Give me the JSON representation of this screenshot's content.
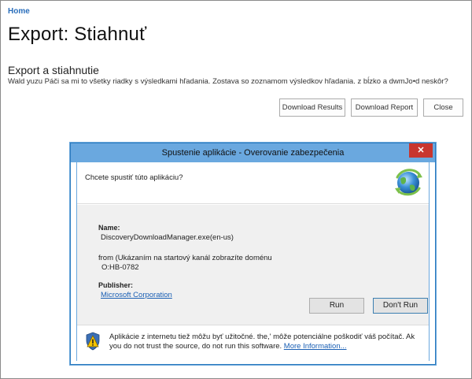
{
  "page": {
    "home_link": "Home",
    "title": "Export: Stiahnuť",
    "section_title": "Export a stiahnutie",
    "section_description": "Wald yuzu Páči sa mi to všetky riadky s výsledkami hľadania. Zostava so zoznamom výsledkov hľadania. z bĺzko a dwmJo•d neskôr?"
  },
  "toolbar": {
    "download_results": "Download Results",
    "download_report": "Download Report",
    "close": "Close"
  },
  "dialog": {
    "title": "Spustenie aplikácie - Overovanie zabezpečenia",
    "close_glyph": "✕",
    "question": "Chcete spustiť túto aplikáciu?",
    "name_label": "Name:",
    "name_value": "DiscoveryDownloadManager.exe(en-us)",
    "from_line_1": "from (Ukázaním na startový kanál zobrazíte doménu",
    "from_line_2": "O:HB-0782",
    "publisher_label": "Publisher:",
    "publisher_value": "Microsoft Corporation",
    "run_button": "Run",
    "dont_run_button": "Don't Run",
    "warning_line_1": "Aplikácie z internetu tiež môžu byť užitočné. the,' môže potenciálne poškodiť váš počítač. Ak",
    "warning_line_2_prefix": "you do not trust the source, do not run this software.",
    "more_information": "More Information..."
  },
  "colors": {
    "link": "#2a6ebb",
    "titlebar": "#6aa8df",
    "close_button": "#c8362f",
    "shield_yellow": "#f5c400"
  },
  "icons": {
    "app": "clickonce-app-icon",
    "warning": "warning-shield-icon",
    "close": "close-icon"
  }
}
